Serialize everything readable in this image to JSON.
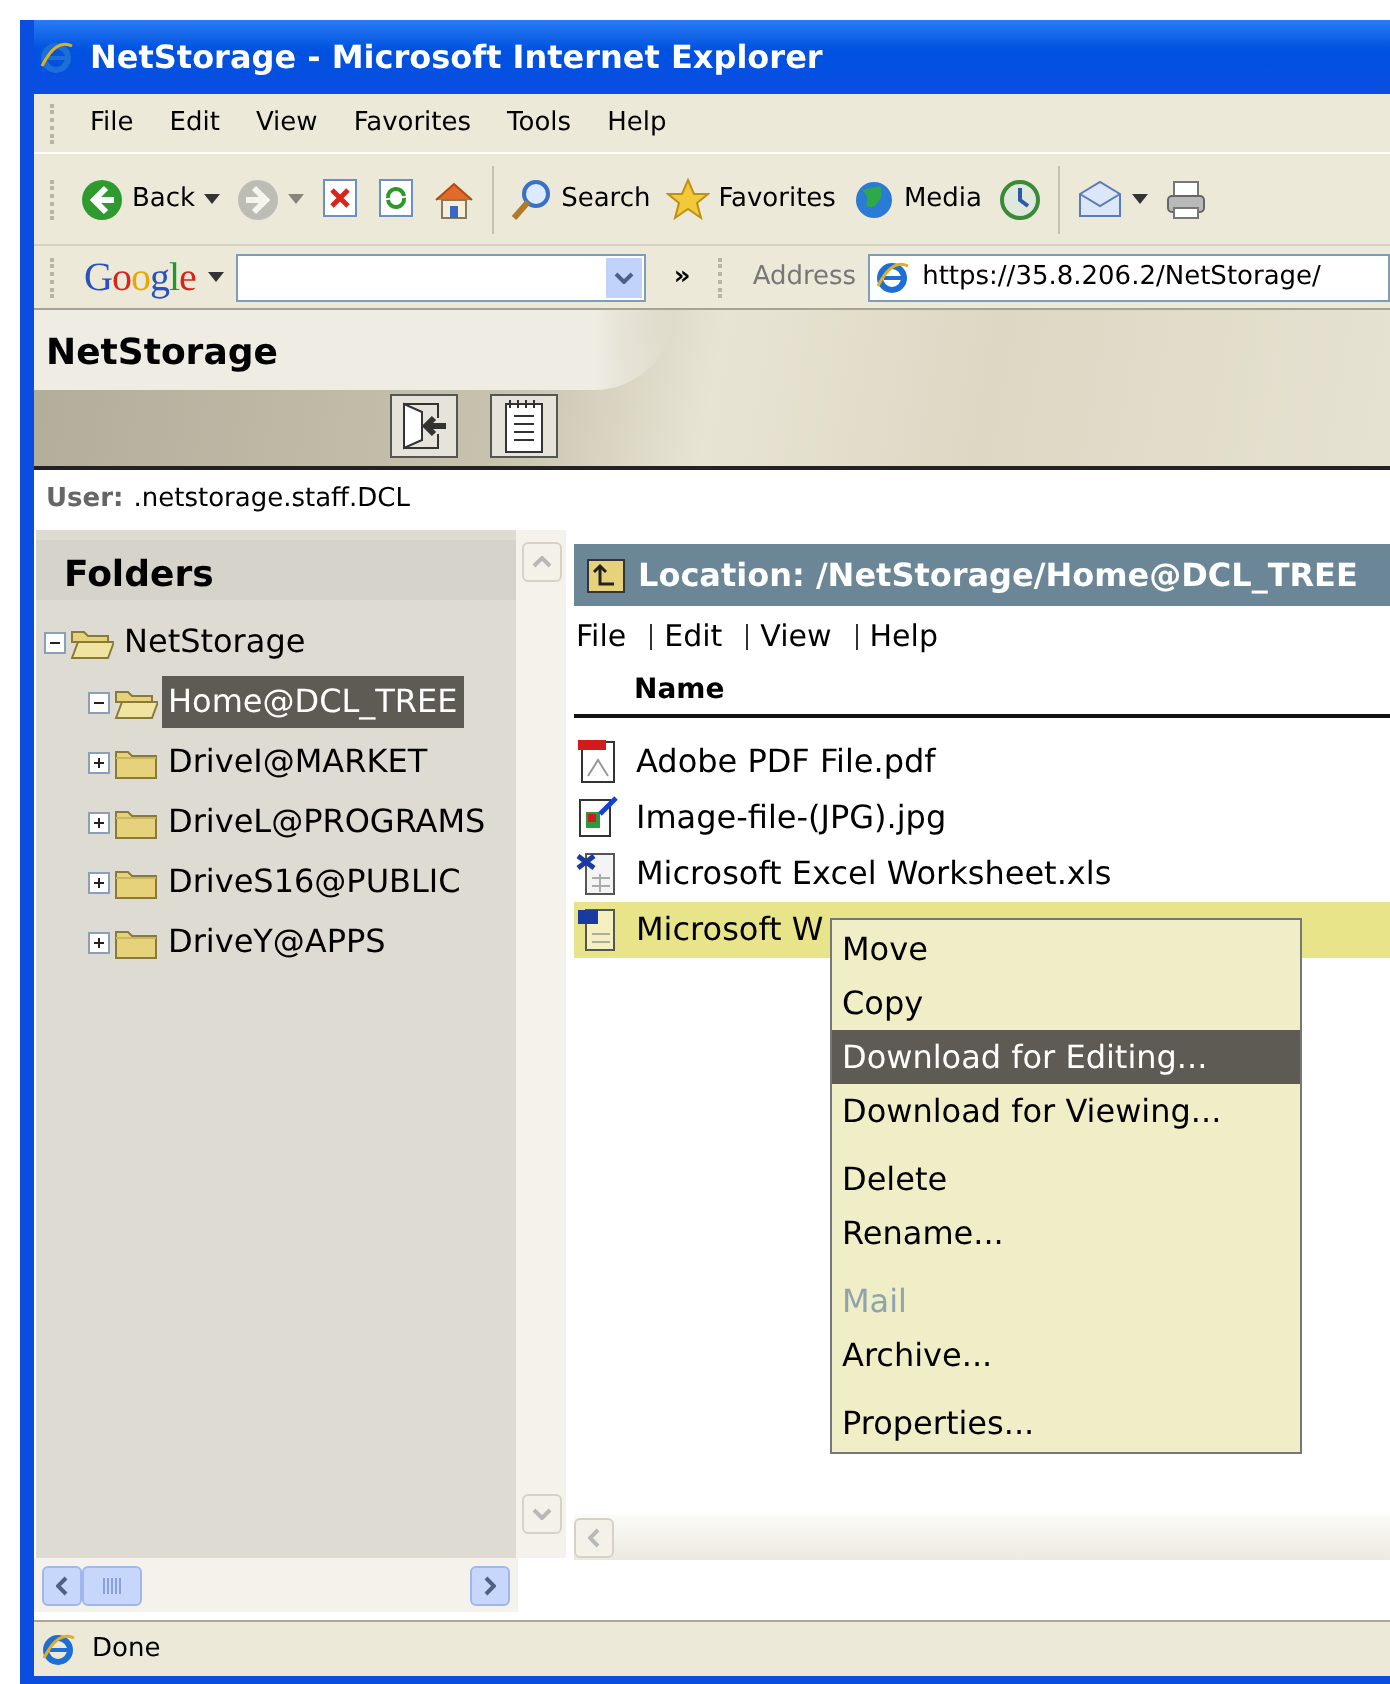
{
  "window": {
    "title": "NetStorage - Microsoft Internet Explorer"
  },
  "menu_bar": [
    "File",
    "Edit",
    "View",
    "Favorites",
    "Tools",
    "Help"
  ],
  "toolbar": [
    {
      "kind": "back",
      "label": "Back",
      "dropdown": true,
      "disabled": false
    },
    {
      "kind": "forward",
      "dropdown": true,
      "disabled": true
    },
    {
      "kind": "stop",
      "dropdown": false,
      "disabled": false
    },
    {
      "kind": "refresh",
      "dropdown": false,
      "disabled": false
    },
    {
      "kind": "home",
      "dropdown": false,
      "disabled": false
    },
    {
      "kind": "search",
      "label": "Search",
      "dropdown": false,
      "disabled": false
    },
    {
      "kind": "favorites",
      "label": "Favorites",
      "dropdown": false,
      "disabled": false
    },
    {
      "kind": "media",
      "label": "Media",
      "dropdown": false,
      "disabled": false
    },
    {
      "kind": "history",
      "dropdown": false,
      "disabled": false
    },
    {
      "kind": "mail",
      "dropdown": true,
      "disabled": false
    },
    {
      "kind": "print",
      "dropdown": false,
      "disabled": false
    }
  ],
  "google_bar": {
    "logo": "Google",
    "more": "»"
  },
  "address_bar": {
    "label": "Address",
    "url": "https://35.8.206.2/NetStorage/"
  },
  "banner": {
    "title": "NetStorage"
  },
  "user": {
    "label": "User:",
    "value": ".netstorage.staff.DCL"
  },
  "folders": {
    "title": "Folders",
    "tree": [
      {
        "label": "NetStorage",
        "expanded": true,
        "selected": false,
        "children": [
          {
            "label": "Home@DCL_TREE",
            "expanded": true,
            "selected": true
          },
          {
            "label": "DriveI@MARKET",
            "expanded": false,
            "selected": false
          },
          {
            "label": "DriveL@PROGRAMS",
            "expanded": false,
            "selected": false
          },
          {
            "label": "DriveS16@PUBLIC",
            "expanded": false,
            "selected": false
          },
          {
            "label": "DriveY@APPS",
            "expanded": false,
            "selected": false
          }
        ]
      }
    ]
  },
  "location": {
    "text": "Location: /NetStorage/Home@DCL_TREE"
  },
  "file_menu": [
    "File",
    "Edit",
    "View",
    "Help"
  ],
  "columns": [
    "Name"
  ],
  "files": [
    {
      "name": "Adobe PDF File.pdf",
      "kind": "pdf",
      "selected": false
    },
    {
      "name": "Image-file-(JPG).jpg",
      "kind": "image",
      "selected": false
    },
    {
      "name": "Microsoft Excel Worksheet.xls",
      "kind": "excel",
      "selected": false
    },
    {
      "name": "Microsoft W",
      "kind": "word",
      "selected": true
    }
  ],
  "context_menu": [
    {
      "label": "Move",
      "selected": false,
      "disabled": false,
      "gap_before": false
    },
    {
      "label": "Copy",
      "selected": false,
      "disabled": false,
      "gap_before": false
    },
    {
      "label": "Download for Editing...",
      "selected": true,
      "disabled": false,
      "gap_before": false
    },
    {
      "label": "Download for Viewing...",
      "selected": false,
      "disabled": false,
      "gap_before": false
    },
    {
      "label": "Delete",
      "selected": false,
      "disabled": false,
      "gap_before": true
    },
    {
      "label": "Rename...",
      "selected": false,
      "disabled": false,
      "gap_before": false
    },
    {
      "label": "Mail",
      "selected": false,
      "disabled": true,
      "gap_before": true
    },
    {
      "label": "Archive...",
      "selected": false,
      "disabled": false,
      "gap_before": false
    },
    {
      "label": "Properties...",
      "selected": false,
      "disabled": false,
      "gap_before": true
    }
  ],
  "status_bar": {
    "text": "Done"
  }
}
